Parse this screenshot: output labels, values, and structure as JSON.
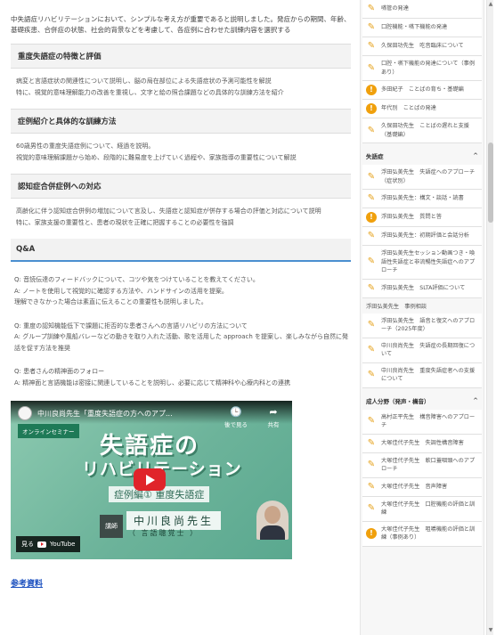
{
  "article": {
    "intro": "中失語症リハビリテーションにおいて、シンプルな考え方が重要であると説明しました。発症からの期間、年齢、基礎疾患、合併症の状態、社会的背景などを考慮して、各症例に合わせた訓練内容を選択する",
    "sections": [
      {
        "heading": "重度失語症の特徴と評価",
        "body": "病変と言語症状の関連性について説明し、脳の局在部位による失語症状の予測可能性を解説\n特に、視覚的意味理解能力の改善を重視し、文字と絵の照合課題などの具体的な訓練方法を紹介"
      },
      {
        "heading": "症例紹介と具体的な訓練方法",
        "body": "60歳男性の重度失語症例について、経過を説明。\n視覚的意味理解課題から始め、段階的に難易度を上げていく過程や、家族指導の重要性について解説"
      },
      {
        "heading": "認知症合併症例への対応",
        "body": "高齢化に伴う認知症合併例の増加について言及し、失語症と認知症が併存する場合の評価と対応について説明\n特に、家族支援の重要性と、患者の現状を正確に把握することの必要性を強調"
      }
    ],
    "qa_heading": "Q&A",
    "qa": [
      {
        "q": "Q: 音読伝達のフィードバックについて、コツや気をつけていることを教えてください。",
        "a": "A: ノートを使用して視覚的に確認する方法や、ハンドサインの活用を提案。\n理解できなかった場合は素直に伝えることの重要性も説明しました。"
      },
      {
        "q": "Q: 重度の認知機能低下で課題に拒否的な患者さんへの言語リハビリの方法について",
        "a": "A: グループ訓練や風船バレーなどの動きを取り入れた活動、歌を活用した approach を提案し、楽しみながら自然に発話を促す方法を推奨"
      },
      {
        "q": "Q: 患者さんの精神面のフォロー",
        "a": "A: 精神面と言語機能は密接に関連していることを説明し、必要に応じて精神科や心療内科との連携"
      }
    ],
    "reference_link": "参考資料"
  },
  "video": {
    "title": "中川良尚先生「重度失語症の方へのアプ...",
    "watch_later": "後で見る",
    "share": "共有",
    "tag": "オンラインセミナー",
    "big_line1": "失語症の",
    "big_line2": "リハビリテーション",
    "subtitle": "症例編① 重度失語症",
    "lecturer_tag": "講師",
    "lecturer_name": "中川良尚先生",
    "lecturer_role": "（ 言語聴覚士 ）",
    "watch_on": "見る",
    "youtube": "YouTube",
    "accent": "#e0242a"
  },
  "sidebar": {
    "top_items": [
      {
        "icon": "pencil",
        "label": "嚥管の発達"
      },
      {
        "icon": "pencil",
        "label": "口腔機能・嚥下機能の発達"
      },
      {
        "icon": "pencil",
        "label": "久保田功先生　吃音臨床について"
      },
      {
        "icon": "pencil",
        "label": "口腔・嚥下機能の発達について（事例あり）"
      },
      {
        "icon": "warn",
        "label": "多田紀子　ことばの育ち・基礎編"
      },
      {
        "icon": "warn",
        "label": "年代別　ことばの発達"
      },
      {
        "icon": "pencil",
        "label": "久保田功先生　ことばの遅れと支援（基礎編）"
      }
    ],
    "aphasia_heading": "失語症",
    "aphasia_items": [
      {
        "icon": "pencil",
        "label": "浮田弘美先生　失語症へのアプローチ（症状別）"
      },
      {
        "icon": "pencil",
        "label": "浮田弘美先生：構文・談話・読書"
      },
      {
        "icon": "warn",
        "label": "浮田弘美先生　質問と答"
      },
      {
        "icon": "pencil",
        "label": "浮田弘美先生：初期評価と会話分析"
      },
      {
        "icon": "pencil",
        "label": "浮田弘美先生セッション動画つき・喚語性失語症と非流暢性失語症へのアプローチ"
      },
      {
        "icon": "pencil",
        "label": "浮田弘美先生　SLTA評価について"
      }
    ],
    "aphasia_sub": "浮田弘美先生　事例相談",
    "aphasia_items2": [
      {
        "icon": "pencil",
        "label": "浮田弘美先生　語音と復文へのアプローチ（2025年度）"
      },
      {
        "icon": "pencil",
        "label": "中川良尚先生　失語症の長期回復について"
      },
      {
        "icon": "pencil",
        "label": "中川良尚先生　重度失語症者への支援について"
      }
    ],
    "adult_heading": "成人分野（発声・構音）",
    "adult_items": [
      {
        "icon": "pencil",
        "label": "高村正平先生　構音障害へのアプローチ"
      },
      {
        "icon": "pencil",
        "label": "大塚佳代子先生　失調性構音障害"
      },
      {
        "icon": "pencil",
        "label": "大塚佳代子先生　軟口蓋咽頭へのアプローチ"
      },
      {
        "icon": "pencil",
        "label": "大塚佳代子先生　音声障害"
      },
      {
        "icon": "pencil",
        "label": "大塚佳代子先生　口腔機能の評価と訓練"
      },
      {
        "icon": "warn",
        "label": "大塚佳代子先生　咀嚼機能の評価と訓練（事例あり）"
      }
    ]
  }
}
